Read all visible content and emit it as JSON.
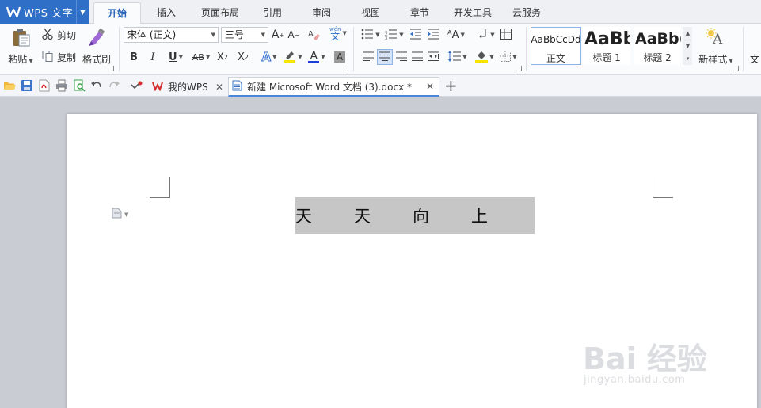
{
  "app": {
    "name": "WPS 文字",
    "logo_letter": "W"
  },
  "menu_tabs": [
    "开始",
    "插入",
    "页面布局",
    "引用",
    "审阅",
    "视图",
    "章节",
    "开发工具",
    "云服务"
  ],
  "active_tab": "开始",
  "clipboard": {
    "paste": "粘贴",
    "cut": "剪切",
    "copy": "复制",
    "format_painter": "格式刷"
  },
  "font": {
    "name": "宋体 (正文)",
    "size": "三号",
    "grow": "A",
    "shrink": "A",
    "bold": "B",
    "italic": "I",
    "underline": "U",
    "strike": "AB",
    "superscript": "X",
    "subscript": "X",
    "phonetic": "文",
    "phonetic_top": "wén",
    "text_effect": "A",
    "font_color": "A",
    "char_shade": "A",
    "font_color_hex": "#1a3fd6",
    "highlight_hex": "#f7e400"
  },
  "styles": [
    {
      "sample": "AaBbCcDd",
      "name": "正文"
    },
    {
      "sample": "AaBb",
      "name": "标题 1"
    },
    {
      "sample": "AaBb(",
      "name": "标题 2"
    }
  ],
  "new_style": "新样式",
  "text_tool": "文",
  "doc_tabs": [
    {
      "label": "我的WPS",
      "active": false
    },
    {
      "label": "新建 Microsoft Word 文档 (3).docx *",
      "active": true
    }
  ],
  "document": {
    "chars": [
      "天",
      "天",
      "向",
      "上"
    ],
    "selection_color": "#c6c6c6"
  },
  "watermark": {
    "logo": "Bai  经验",
    "url": "jingyan.baidu.com"
  },
  "colors": {
    "accent": "#2f6fc7",
    "tab_active_text": "#2a64b6",
    "workspace_bg": "#c9ccd3"
  }
}
